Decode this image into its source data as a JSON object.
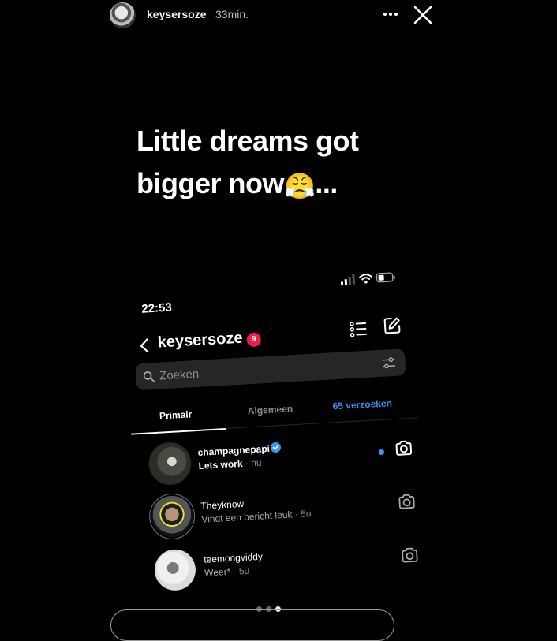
{
  "story": {
    "username": "keysersoze",
    "time": "33min.",
    "caption_line1": "Little dreams got",
    "caption_line2": "bigger now",
    "caption_emoji": "😤",
    "caption_suffix": "...",
    "total_segments": 3,
    "active_segment": 3
  },
  "dm_screen": {
    "status_time": "22:53",
    "title": "keysersoze",
    "badge_count": "9",
    "search_placeholder": "Zoeken",
    "tabs": [
      "Primair",
      "Algemeen",
      "65 verzoeken"
    ],
    "active_tab": "Primair",
    "chats": [
      {
        "name": "champagnepapi",
        "verified": true,
        "message": "Lets work",
        "meta": "· nu",
        "unread": true
      },
      {
        "name": "Theyknow",
        "verified": false,
        "message": "Vindt een bericht leuk",
        "meta": "· 5u",
        "unread": false
      },
      {
        "name": "teemongviddy",
        "verified": false,
        "message": "Weer*",
        "meta": "· 5u",
        "unread": false
      }
    ]
  },
  "colors": {
    "background": "#000000",
    "accent_blue": "#3897f0",
    "badge_red": "#ed1e48"
  }
}
